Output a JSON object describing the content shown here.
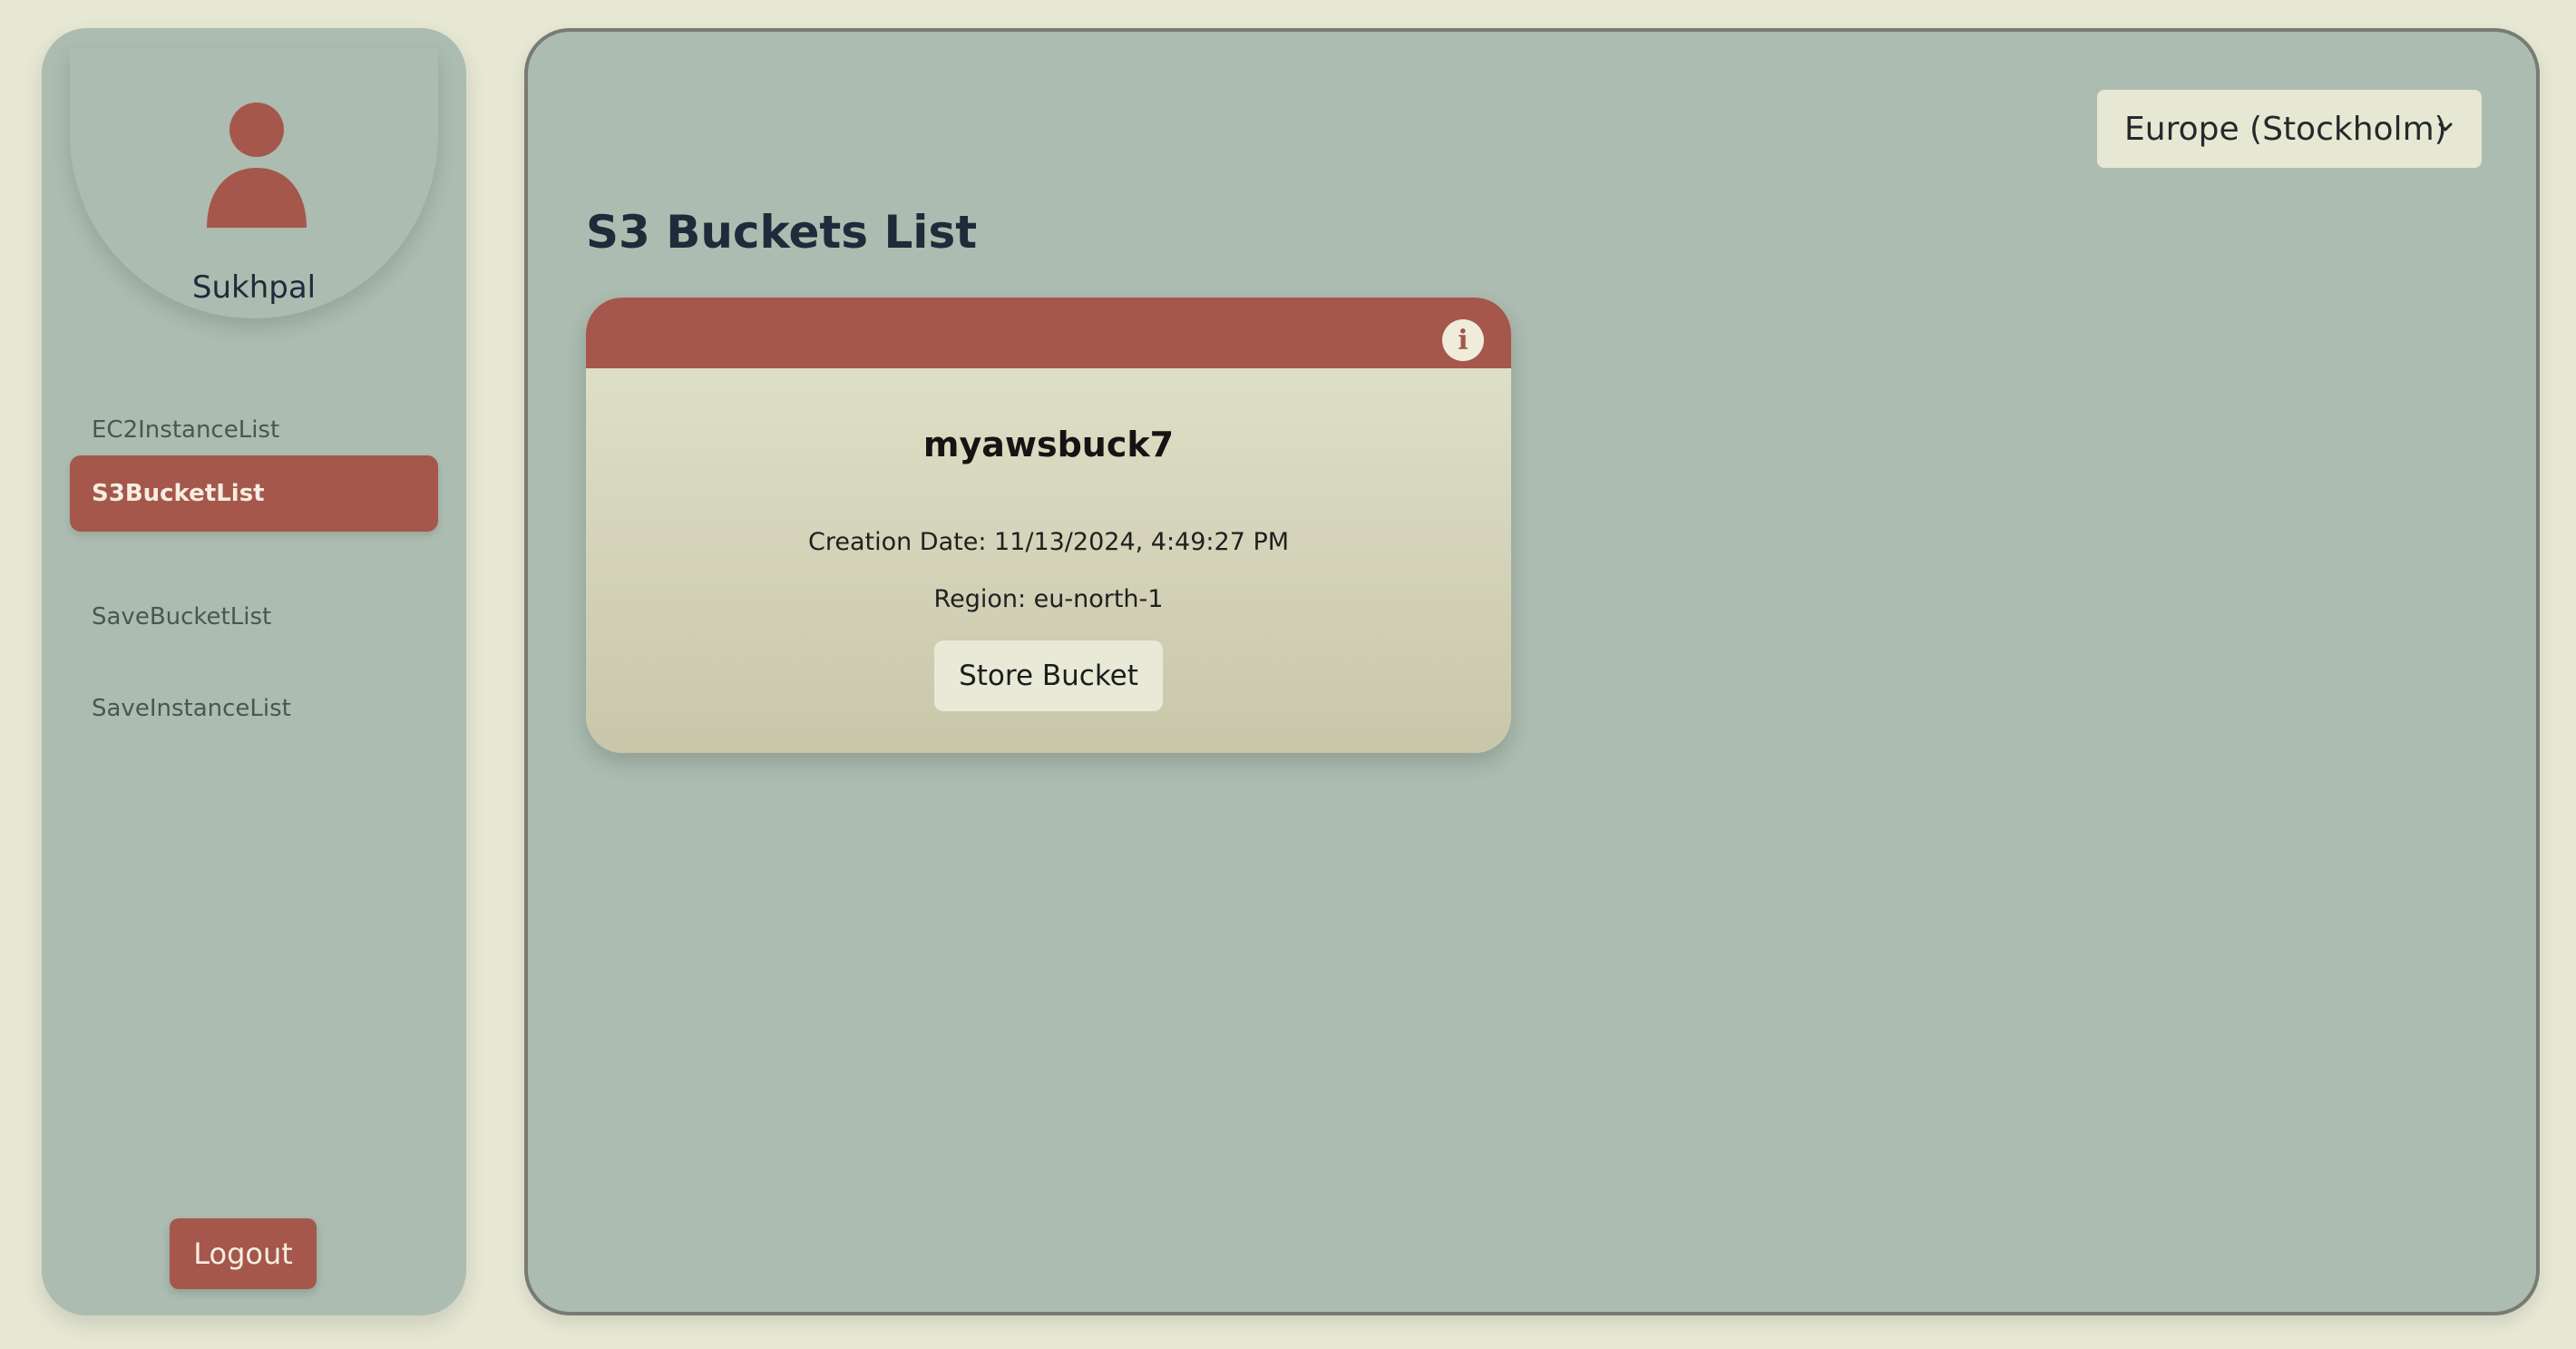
{
  "user": {
    "name": "Sukhpal"
  },
  "sidebar": {
    "items": [
      {
        "label": "EC2InstanceList",
        "active": false
      },
      {
        "label": "S3BucketList",
        "active": true
      },
      {
        "label": "SaveBucketList",
        "active": false
      },
      {
        "label": "SaveInstanceList",
        "active": false
      }
    ],
    "logout_label": "Logout"
  },
  "header": {
    "region": "Europe (Stockholm)"
  },
  "main": {
    "title": "S3 Buckets List",
    "buckets": [
      {
        "name": "myawsbuck7",
        "creation_date": "Creation Date: 11/13/2024, 4:49:27 PM",
        "region": "Region: eu-north-1",
        "action_label": "Store Bucket"
      }
    ]
  },
  "colors": {
    "accent": "#a5574b",
    "panel": "#acbcb0",
    "background": "#e6e8d4",
    "card_top": "#e2e3cc",
    "card_bottom": "#c9c7aa",
    "text_dark": "#1f2a3a"
  },
  "icons": {
    "avatar": "user-icon",
    "info": "info-icon",
    "dropdown": "chevron-down-icon"
  }
}
